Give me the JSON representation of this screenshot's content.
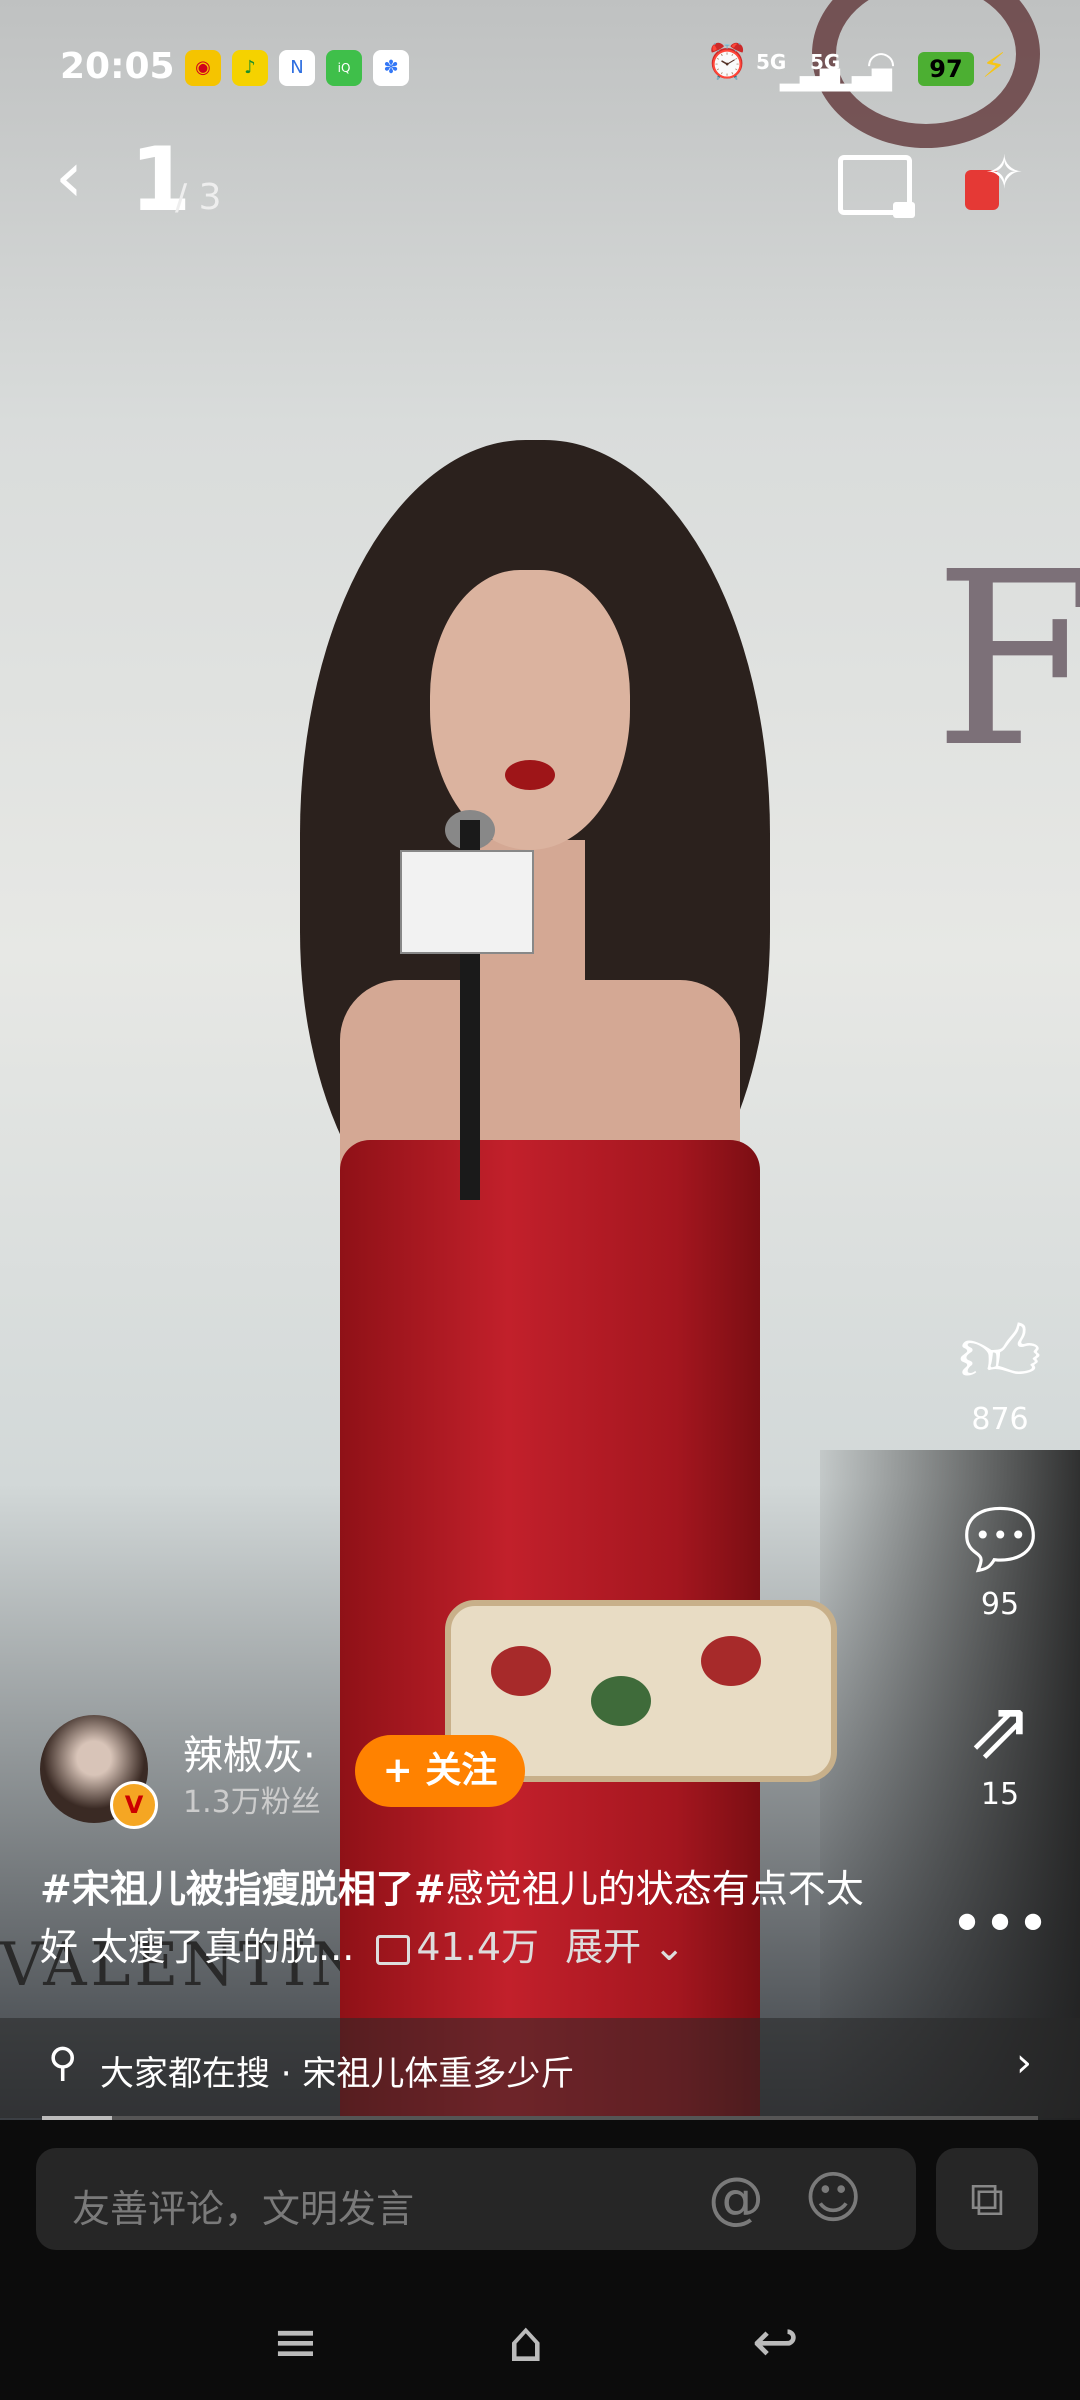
{
  "status_bar": {
    "time": "20:05",
    "apps": [
      {
        "icon": "weibo-icon",
        "color": "#f5c400"
      },
      {
        "icon": "qq-music-icon",
        "color": "#f5d200"
      },
      {
        "icon": "news-icon",
        "color": "#2f6fe0"
      },
      {
        "icon": "iqiyi-icon",
        "color": "#3fbf4a"
      },
      {
        "icon": "baidu-icon",
        "color": "#3478f6"
      }
    ],
    "network_1": "5G",
    "network_2": "5G",
    "battery": "97"
  },
  "nav": {
    "page_current": "1",
    "page_total": "/ 3"
  },
  "actions": {
    "like_count": "876",
    "comment_count": "95",
    "share_count": "15"
  },
  "author": {
    "name": "辣椒灰·",
    "fans": "1.3万粉丝",
    "follow_label": "+ 关注",
    "verified_badge": "V"
  },
  "caption": {
    "hashtag": "#宋祖儿被指瘦脱相了#",
    "text": "感觉祖儿的状态有点不太好 太瘦了真的脱...",
    "views": "41.4万",
    "expand": "展开"
  },
  "search": {
    "text": "大家都在搜 · 宋祖儿体重多少斤"
  },
  "progress": 0.07,
  "comment_input": {
    "placeholder": "友善评论，文明发言"
  },
  "scene": {
    "wall_letter": "F",
    "bottom_logo": "VALENTINO"
  }
}
